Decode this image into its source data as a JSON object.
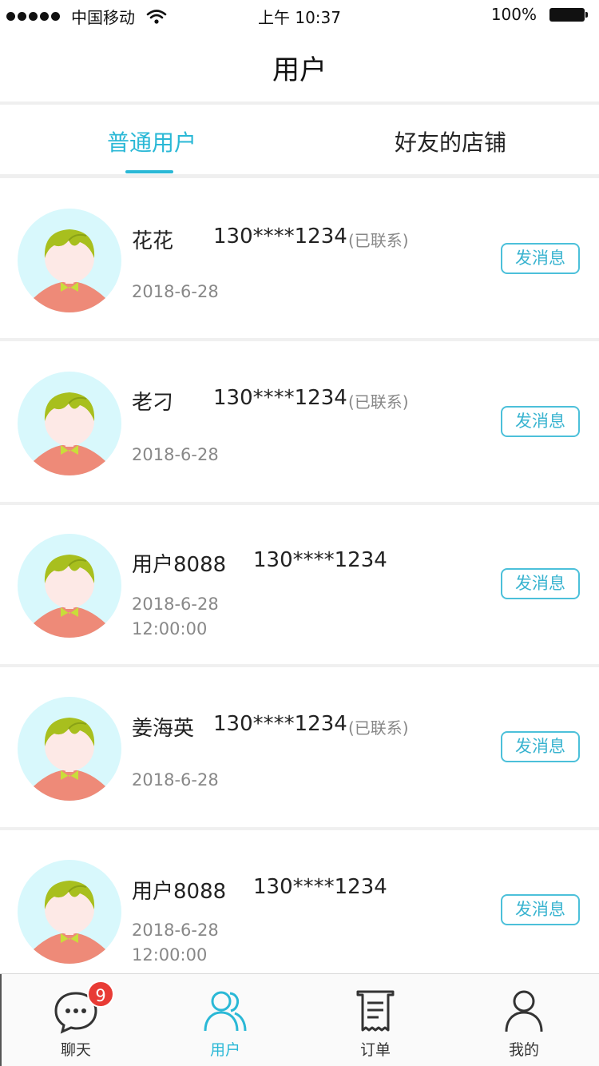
{
  "status_bar": {
    "carrier": "中国移动",
    "time": "上午 10:37",
    "battery": "100%"
  },
  "nav": {
    "title": "用户"
  },
  "tabs": [
    {
      "label": "普通用户",
      "active": true
    },
    {
      "label": "好友的店铺",
      "active": false
    }
  ],
  "users": [
    {
      "name": "花花",
      "phone": "130****1234",
      "status": "(已联系)",
      "date": "2018-6-28",
      "time": "",
      "action": "发消息"
    },
    {
      "name": "老刁",
      "phone": "130****1234",
      "status": "(已联系)",
      "date": "2018-6-28",
      "time": "",
      "action": "发消息"
    },
    {
      "name": "用户8088",
      "phone": "130****1234",
      "status": "",
      "date": "2018-6-28",
      "time": "12:00:00",
      "action": "发消息"
    },
    {
      "name": "姜海英",
      "phone": "130****1234",
      "status": "(已联系)",
      "date": "2018-6-28",
      "time": "",
      "action": "发消息"
    },
    {
      "name": "用户8088",
      "phone": "130****1234",
      "status": "",
      "date": "2018-6-28",
      "time": "12:00:00",
      "action": "发消息"
    }
  ],
  "tabbar": {
    "items": [
      {
        "label": "聊天",
        "icon": "chat-bubble-icon",
        "badge": "9"
      },
      {
        "label": "用户",
        "icon": "users-icon",
        "active": true
      },
      {
        "label": "订单",
        "icon": "receipt-icon"
      },
      {
        "label": "我的",
        "icon": "person-icon"
      }
    ]
  },
  "colors": {
    "accent": "#2ab8d6",
    "badge": "#e83b35",
    "avatar_bg": "#d8f8fc",
    "hair": "#a8bf1e",
    "shirt": "#ee8a78"
  }
}
